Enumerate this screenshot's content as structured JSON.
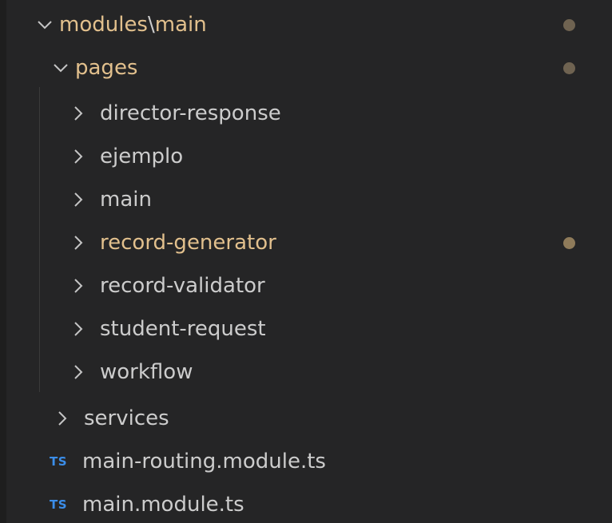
{
  "colors": {
    "background": "#252526",
    "text_default": "#cccccc",
    "text_modified": "#e2c08d",
    "dot_modified": "#6f6351",
    "dot_subtle": "#8f7b5a",
    "ts_icon": "#3b8eea",
    "chevron": "#c5c5c5"
  },
  "tree": {
    "root": {
      "label_parts": [
        "modules",
        "\\",
        "main"
      ],
      "expanded": true,
      "modified": true
    },
    "pages": {
      "label": "pages",
      "expanded": true,
      "modified": true
    },
    "page_items": [
      {
        "label": "director-response",
        "modified": false
      },
      {
        "label": "ejemplo",
        "modified": false
      },
      {
        "label": "main",
        "modified": false
      },
      {
        "label": "record-generator",
        "modified": true
      },
      {
        "label": "record-validator",
        "modified": false
      },
      {
        "label": "student-request",
        "modified": false
      },
      {
        "label": "workflow",
        "modified": false
      }
    ],
    "services": {
      "label": "services",
      "expanded": false
    },
    "files": [
      {
        "icon": "TS",
        "label": "main-routing.module.ts"
      },
      {
        "icon": "TS",
        "label": "main.module.ts"
      }
    ]
  }
}
